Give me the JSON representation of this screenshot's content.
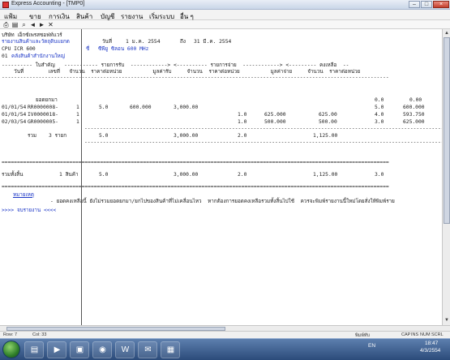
{
  "window": {
    "title": "Express Accounting - [TMP0]",
    "minimize": "–",
    "maximize": "□",
    "close": "×"
  },
  "menu": [
    "แฟ้ม",
    "ขาย",
    "การเงิน",
    "สินค้า",
    "บัญชี",
    "รายงาน",
    "เริ่มระบบ",
    "อื่น ๆ"
  ],
  "toolbar_icons": [
    "printer-icon",
    "print-preview-icon",
    "find-icon",
    "previous-page-icon",
    "next-page-icon",
    "close-icon"
  ],
  "toolbar_glyphs": [
    "⎙",
    "▤",
    "⌕",
    "◄",
    "►",
    "✕"
  ],
  "report": {
    "company": "บริษัท เอ็กซ์เพรสซอฟท์แวร์",
    "report_title": "รายงานสินค้าและวัตถุดิบแยกต",
    "date_label": "วันที่",
    "date_from": "1 ม.ค. 2554",
    "date_to_label": "ถึง",
    "date_to": "31 มี.ค. 2554",
    "item_code": "CPU ICR 600",
    "item_name": "ซีพียู ซิลอน 600 MHz",
    "item_name_prefix": "ชื่",
    "warehouse_code": "01",
    "warehouse_name": "คลังสินค้าสำนักงานใหญ่",
    "header_row1": "---------- ใบสำคัญ   ----------- รายการรับ  ------------> <---------- รายการจ่าย  ------------> <--------- คงเหลือ  --",
    "header_row2": "    วันที่        เลขที่   จำนวน  ราคาต่อหน่วย          มูลค่ารับ     จำนวน  ราคาต่อหน่วย          มูลค่าจ่าย     จำนวน  ราคาต่อหน่วย",
    "separator_dash": "------------------------------------------------------------------------------------------------------------------------------",
    "separator_double": "==============================================================================================================================",
    "opening_label": "ยอดยกมา",
    "opening_qty": "0.0",
    "opening_price": "0.00",
    "rows": [
      {
        "date": "01/01/54",
        "doc": "RR0000008-",
        "line": "1",
        "in_qty": "5.0",
        "in_price": "600.000",
        "in_value": "3,000.00",
        "out_qty": "",
        "out_price": "",
        "out_value": "",
        "bal_qty": "5.0",
        "bal_price": "600.000"
      },
      {
        "date": "01/01/54",
        "doc": "IV0000018-",
        "line": "1",
        "in_qty": "",
        "in_price": "",
        "in_value": "",
        "out_qty": "1.0",
        "out_price": "625.000",
        "out_value": "625.00",
        "bal_qty": "4.0",
        "bal_price": "593.750"
      },
      {
        "date": "02/03/54",
        "doc": "GR0000005-",
        "line": "1",
        "in_qty": "",
        "in_price": "",
        "in_value": "",
        "out_qty": "1.0",
        "out_price": "500.000",
        "out_value": "500.00",
        "bal_qty": "3.0",
        "bal_price": "625.000"
      }
    ],
    "subtotal_label": "รวม",
    "subtotal_count": "3 รายก",
    "subtotal_in_qty": "5.0",
    "subtotal_in_value": "3,000.00",
    "subtotal_out_qty": "2.0",
    "subtotal_out_value": "1,125.00",
    "grand_label": "รวมทั้งสิ้น",
    "grand_count": "1 สินค้า",
    "grand_in_qty": "5.0",
    "grand_in_value": "3,000.00",
    "grand_out_qty": "2.0",
    "grand_out_value": "1,125.00",
    "grand_bal_qty": "3.0",
    "note_label": "หมายเหตุ",
    "note_text": "- ยอดคงเหลือนี้ ยังไม่รวมยอดยกมา/ยกไปของสินค้าที่ไม่เคลื่อนไหว  หากต้องการยอดคงเหลือรวมทั้งสิ้นไปใช้  ควรจะพิมพ์รายงานนี้ใหม่โดยสั่งให้พิมพ์ราย",
    "end_marker": ">>>> จบรายงาน <<<<"
  },
  "statusbar": {
    "row": "Row:   7",
    "col": "Col:  33",
    "mode": "พิมพ์ทับ",
    "caps": "CAP",
    "ins": "INS",
    "num": "NUM",
    "scrl": "SCRL"
  },
  "taskbar": {
    "apps": [
      "folder-icon",
      "media-icon",
      "explorer-icon",
      "chrome-icon",
      "word-icon",
      "mail-icon",
      "accounting-icon"
    ],
    "app_glyphs": [
      "▤",
      "▶",
      "▣",
      "◉",
      "W",
      "✉",
      "▦"
    ],
    "lang": "EN",
    "time": "18:47",
    "date": "4/3/2554"
  }
}
